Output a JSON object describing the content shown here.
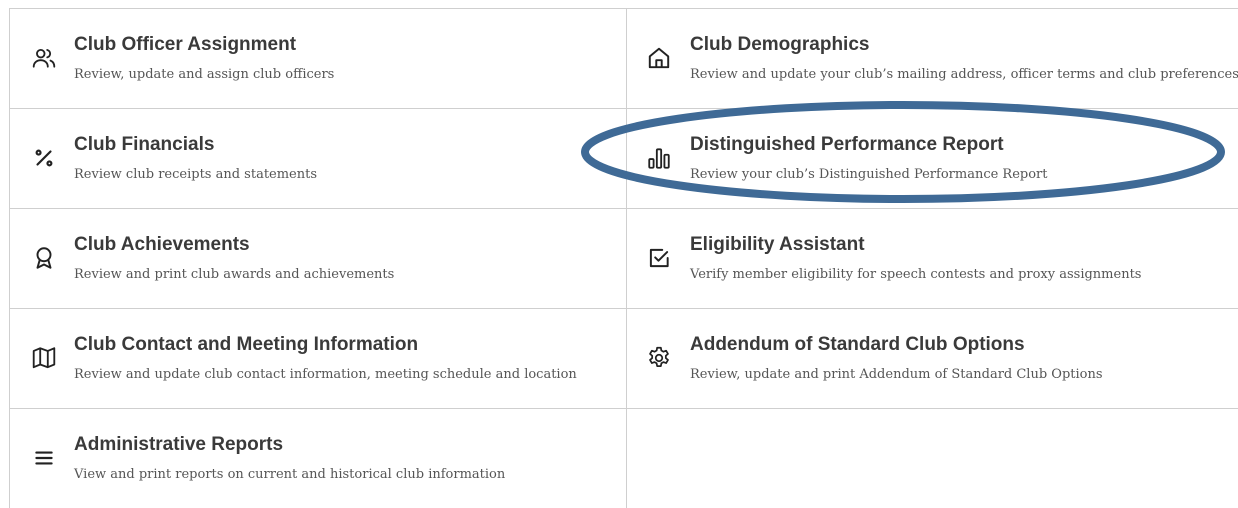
{
  "tiles": [
    {
      "title": "Club Officer Assignment",
      "desc": "Review, update and assign club officers",
      "icon": "users-icon"
    },
    {
      "title": "Club Demographics",
      "desc": "Review and update your club’s mailing address, officer terms and club preferences",
      "icon": "home-icon"
    },
    {
      "title": "Club Financials",
      "desc": "Review club receipts and statements",
      "icon": "percent-icon"
    },
    {
      "title": "Distinguished Performance Report",
      "desc": "Review your club’s Distinguished Performance Report",
      "icon": "bar-chart-icon"
    },
    {
      "title": "Club Achievements",
      "desc": "Review and print club awards and achievements",
      "icon": "award-icon"
    },
    {
      "title": "Eligibility Assistant",
      "desc": "Verify member eligibility for speech contests and proxy assignments",
      "icon": "checkbox-icon"
    },
    {
      "title": "Club Contact and Meeting Information",
      "desc": "Review and update club contact information, meeting schedule and location",
      "icon": "map-icon"
    },
    {
      "title": "Addendum of Standard Club Options",
      "desc": "Review, update and print Addendum of Standard Club Options",
      "icon": "gear-icon"
    },
    {
      "title": "Administrative Reports",
      "desc": "View and print reports on current and historical club information",
      "icon": "menu-icon"
    }
  ],
  "highlight_color": "#3f6a96"
}
